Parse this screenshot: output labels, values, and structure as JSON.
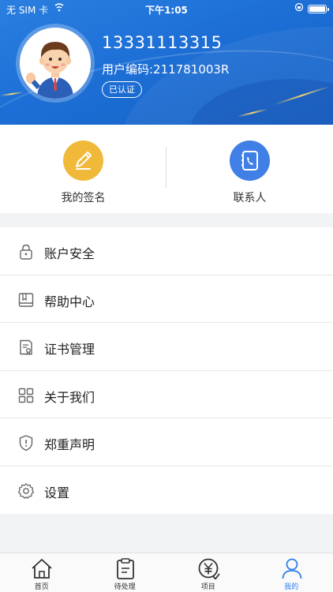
{
  "status_bar": {
    "carrier": "无 SIM 卡",
    "time": "下午1:05"
  },
  "profile": {
    "phone": "13331113315",
    "user_code": "用户编码:211781003R",
    "verified_label": "已认证"
  },
  "quick_actions": [
    {
      "label": "我的签名",
      "icon": "pen-icon",
      "color": "#f0b93a"
    },
    {
      "label": "联系人",
      "icon": "phone-book-icon",
      "color": "#3f7fe6"
    }
  ],
  "menu": [
    {
      "label": "账户安全",
      "icon": "lock-icon"
    },
    {
      "label": "帮助中心",
      "icon": "book-icon"
    },
    {
      "label": "证书管理",
      "icon": "certificate-icon"
    },
    {
      "label": "关于我们",
      "icon": "grid-icon"
    },
    {
      "label": "郑重声明",
      "icon": "shield-icon"
    },
    {
      "label": "设置",
      "icon": "gear-icon"
    }
  ],
  "tabbar": {
    "active_index": 3,
    "active_color": "#2f80ed",
    "tabs": [
      {
        "label": "首页",
        "icon": "home-icon"
      },
      {
        "label": "待处理",
        "icon": "clipboard-icon"
      },
      {
        "label": "项目",
        "icon": "yuan-icon"
      },
      {
        "label": "我的",
        "icon": "user-icon"
      }
    ]
  },
  "colors": {
    "header_blue": "#1d6fd6",
    "pen_yellow": "#f0b93a",
    "contact_blue": "#3f7fe6"
  }
}
